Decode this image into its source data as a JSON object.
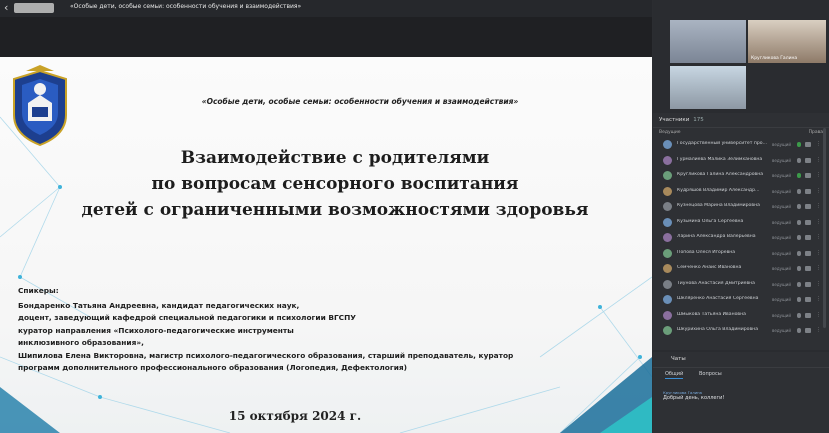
{
  "topbar": {
    "back_icon": "arrow-left-icon",
    "meeting_title": "«Особые дети, особые семьи: особенности обучения и взаимодействия»"
  },
  "slide": {
    "header": "«Особые дети, особые семьи: особенности обучения и взаимодействия»",
    "title_lines": [
      "Взаимодействие с родителями",
      "по вопросам сенсорного воспитания",
      "детей с ограниченными возможностями здоровья"
    ],
    "speakers_label": "Спикеры:",
    "speakers_lines": [
      "Бондаренко Татьяна Андреевна, кандидат педагогических наук,",
      "доцент, заведующий кафедрой специальной педагогики и психологии ВГСПУ",
      "куратор направления «Психолого-педагогические инструменты",
      "инклюзивного образования»,",
      "Шипилова Елена Викторовна, магистр психолого-педагогического образования, старший преподаватель, куратор",
      "программ дополнительного профессионального образования (Логопедия, Дефектология)"
    ],
    "date": "15 октября 2024 г."
  },
  "videos": [
    {
      "name": ""
    },
    {
      "name": "Кругликова Галина"
    },
    {
      "name": ""
    }
  ],
  "participants": {
    "title": "Участники",
    "count": "175",
    "section_label": "Ведущие",
    "right_label": "Права",
    "rows": [
      {
        "name": "Государственный университет про...",
        "role": "ведущий",
        "mic_on": true
      },
      {
        "name": "Гурмалиева Малика Зелимхановна",
        "role": "ведущий",
        "mic_on": false
      },
      {
        "name": "Кругликова Галина Александровна",
        "role": "ведущий",
        "mic_on": true
      },
      {
        "name": "Кудряшов Владимир Александр...",
        "role": "ведущий",
        "mic_on": false
      },
      {
        "name": "Кузнецова Марина Владимировна",
        "role": "ведущий",
        "mic_on": false
      },
      {
        "name": "Кузьмина Ольга Сергеевна",
        "role": "ведущий",
        "mic_on": false
      },
      {
        "name": "Ларина Александра Валерьевна",
        "role": "ведущий",
        "mic_on": false
      },
      {
        "name": "Попова Олеся Игоревна",
        "role": "ведущий",
        "mic_on": false
      },
      {
        "name": "Сёмченко Анаис Ивановна",
        "role": "ведущий",
        "mic_on": false
      },
      {
        "name": "Тиунова Анастасия Дмитриевна",
        "role": "ведущий",
        "mic_on": false
      },
      {
        "name": "Шкляренко Анастасия Сергеевна",
        "role": "ведущий",
        "mic_on": false
      },
      {
        "name": "Шмыкова Татьяна Ивановна",
        "role": "ведущий",
        "mic_on": false
      },
      {
        "name": "Шкурихина Ольга Владимировна",
        "role": "ведущий",
        "mic_on": false
      }
    ]
  },
  "chat": {
    "title": "Чаты",
    "tabs": [
      "Общий",
      "Вопросы"
    ],
    "messages": [
      {
        "meta": "Кругликова Галина",
        "text": "Добрый день, коллеги!"
      },
      {
        "meta": "",
        "text": ""
      }
    ]
  }
}
